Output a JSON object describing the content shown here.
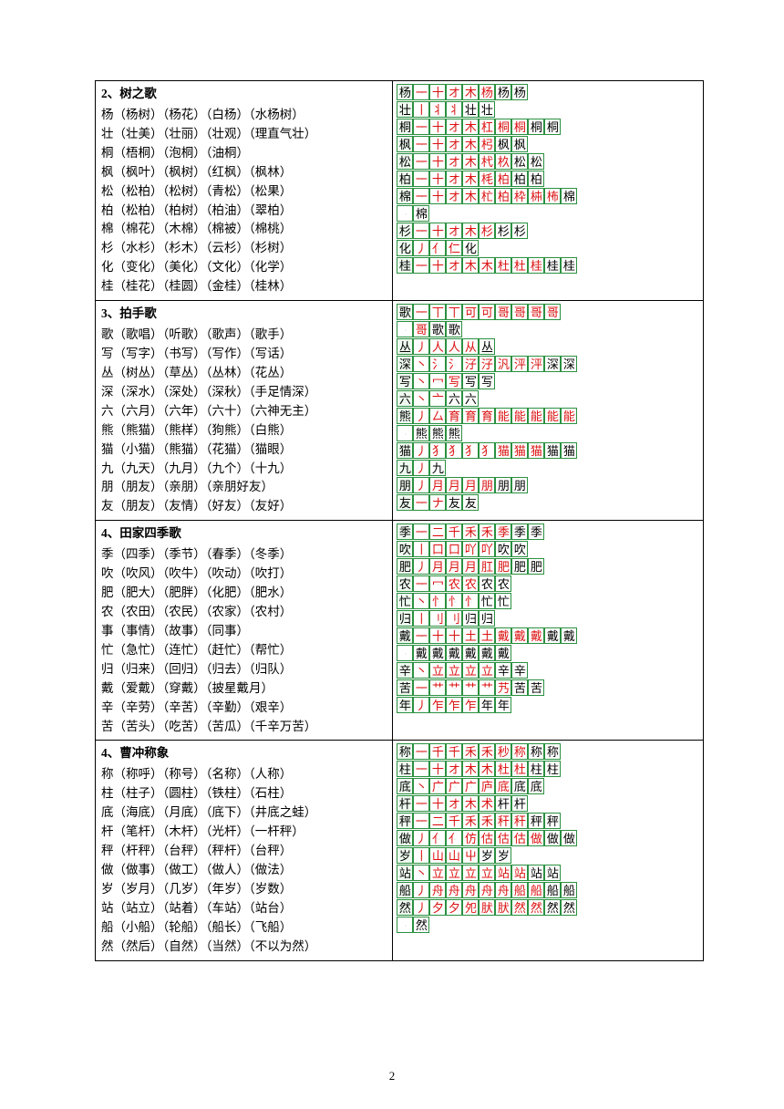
{
  "page_number": "2",
  "sections": [
    {
      "num": "2、",
      "title": "树之歌",
      "entries": [
        "杨（杨树）（杨花）（白杨）（水杨树）",
        "壮（壮美）（壮丽）（壮观）（理直气壮）",
        "桐（梧桐）（泡桐）（油桐）",
        "枫（枫叶）（枫树）（红枫）（枫林）",
        "松（松柏）（松树）（青松）（松果）",
        "柏（松柏）（柏树）（柏油）（翠柏）",
        "棉（棉花）（木棉）（棉被）（棉桃）",
        "杉（水杉）（杉木）（云杉）（杉树）",
        "化（变化）（美化）（文化）（化学）",
        "桂（桂花）（桂圆）（金桂）（桂林）"
      ],
      "strokes": [
        {
          "head": "杨",
          "cells": [
            "一",
            "十",
            "オ",
            "木",
            "杨",
            "杨",
            "杨"
          ]
        },
        {
          "head": "壮",
          "cells": [
            "丨",
            "丬",
            "丬",
            "壮",
            "壮"
          ]
        },
        {
          "head": "桐",
          "cells": [
            "一",
            "十",
            "オ",
            "木",
            "杠",
            "桐",
            "桐",
            "桐",
            "桐"
          ]
        },
        {
          "head": "枫",
          "cells": [
            "一",
            "十",
            "オ",
            "木",
            "杛",
            "枫",
            "枫"
          ]
        },
        {
          "head": "松",
          "cells": [
            "一",
            "十",
            "オ",
            "木",
            "杙",
            "杦",
            "松",
            "松"
          ]
        },
        {
          "head": "柏",
          "cells": [
            "一",
            "十",
            "オ",
            "木",
            "枆",
            "柏",
            "柏",
            "柏"
          ]
        },
        {
          "head": "棉",
          "cells": [
            "一",
            "十",
            "オ",
            "木",
            "杧",
            "柏",
            "枠",
            "枾",
            "柨",
            "棉"
          ],
          "cont": [
            "棉"
          ]
        },
        {
          "head": "杉",
          "cells": [
            "一",
            "十",
            "オ",
            "木",
            "杉",
            "杉",
            "杉"
          ]
        },
        {
          "head": "化",
          "cells": [
            "丿",
            "亻",
            "仁",
            "化"
          ]
        },
        {
          "head": "桂",
          "cells": [
            "一",
            "十",
            "オ",
            "木",
            "木",
            "杜",
            "杜",
            "桂",
            "桂",
            "桂"
          ]
        }
      ]
    },
    {
      "num": "3、",
      "title": "拍手歌",
      "entries": [
        "歌（歌唱）（听歌）（歌声）（歌手）",
        "写（写字）（书写）（写作）（写话）",
        "丛（树丛）（草丛）（丛林）（花丛）",
        "深（深水）（深处）（深秋）（手足情深）",
        "六（六月）（六年）（六十）（六神无主）",
        "熊（熊猫）（熊样）（狗熊）（白熊）",
        "猫（小猫）（熊猫）（花猫）（猫眼）",
        "九（九天）（九月）（九个）（十九）",
        "朋（朋友）（亲朋）（亲朋好友）",
        "友（朋友）（友情）（好友）（友好）"
      ],
      "strokes": [
        {
          "head": "歌",
          "cells": [
            "一",
            "丅",
            "丅",
            "可",
            "可",
            "哥",
            "哥",
            "哥",
            "哥"
          ],
          "cont": [
            "哥",
            "歌",
            "歌"
          ]
        },
        {
          "head": "丛",
          "cells": [
            "丿",
            "人",
            "人",
            "从",
            "丛"
          ]
        },
        {
          "head": "深",
          "cells": [
            "丶",
            "氵",
            "氵",
            "汓",
            "汓",
            "汎",
            "泙",
            "泙",
            "深",
            "深"
          ]
        },
        {
          "head": "写",
          "cells": [
            "丶",
            "冖",
            "写",
            "写",
            "写"
          ]
        },
        {
          "head": "六",
          "cells": [
            "丶",
            "亠",
            "六",
            "六"
          ]
        },
        {
          "head": "熊",
          "cells": [
            "丿",
            "厶",
            "育",
            "育",
            "育",
            "能",
            "能",
            "能",
            "能",
            "能"
          ],
          "cont": [
            "熊",
            "熊",
            "熊"
          ]
        },
        {
          "head": "猫",
          "cells": [
            "丿",
            "犭",
            "犭",
            "犭",
            "犭",
            "猫",
            "猫",
            "猫",
            "猫",
            "猫"
          ]
        },
        {
          "head": "九",
          "cells": [
            "丿",
            "九"
          ]
        },
        {
          "head": "朋",
          "cells": [
            "丿",
            "月",
            "月",
            "月",
            "朋",
            "朋",
            "朋"
          ]
        },
        {
          "head": "友",
          "cells": [
            "一",
            "ナ",
            "友",
            "友"
          ]
        }
      ]
    },
    {
      "num": "4、",
      "title": "田家四季歌",
      "entries": [
        "季（四季）（季节）（春季）（冬季）",
        "吹（吹风）（吹牛）（吹动）（吹打）",
        "肥（肥大）（肥胖）（化肥）（肥水）",
        "农（农田）（农民）（农家）（农村）",
        "事（事情）（故事）（同事）",
        "忙（急忙）（连忙）（赶忙）（帮忙）",
        "归（归来）（回归）（归去）（归队）",
        "戴（爱戴）（穿戴）（披星戴月）",
        "辛（辛劳）（辛苦）（辛勤）（艰辛）",
        "苦（苦头）（吃苦）（苦瓜）（千辛万苦）"
      ],
      "strokes": [
        {
          "head": "季",
          "cells": [
            "一",
            "二",
            "千",
            "禾",
            "禾",
            "季",
            "季",
            "季"
          ]
        },
        {
          "head": "吹",
          "cells": [
            "丨",
            "口",
            "口",
            "吖",
            "吖",
            "吹",
            "吹"
          ]
        },
        {
          "head": "肥",
          "cells": [
            "丿",
            "月",
            "月",
            "月",
            "肛",
            "肥",
            "肥",
            "肥"
          ]
        },
        {
          "head": "农",
          "cells": [
            "一",
            "冖",
            "农",
            "农",
            "农",
            "农"
          ]
        },
        {
          "head": "忙",
          "cells": [
            "丶",
            "忄",
            "忄",
            "忄",
            "忙",
            "忙"
          ]
        },
        {
          "head": "归",
          "cells": [
            "丨",
            "刂",
            "刂",
            "归",
            "归"
          ]
        },
        {
          "head": "戴",
          "cells": [
            "一",
            "十",
            "十",
            "土",
            "土",
            "戴",
            "戴",
            "戴",
            "戴",
            "戴"
          ],
          "cont": [
            "戴",
            "戴",
            "戴",
            "戴",
            "戴",
            "戴"
          ]
        },
        {
          "head": "辛",
          "cells": [
            "丶",
            "立",
            "立",
            "立",
            "立",
            "辛",
            "辛"
          ]
        },
        {
          "head": "苦",
          "cells": [
            "一",
            "艹",
            "艹",
            "艹",
            "艹",
            "艿",
            "苦",
            "苦"
          ]
        },
        {
          "head": "年",
          "cells": [
            "丿",
            "乍",
            "乍",
            "乍",
            "年",
            "年"
          ]
        }
      ]
    },
    {
      "num": "4、",
      "title": "曹冲称象",
      "entries": [
        "称（称呼）（称号）（名称）（人称）",
        "柱（柱子）（圆柱）（铁柱）（石柱）",
        "底（海底）（月底）（底下）（井底之蛙）",
        "杆（笔杆）（木杆）（光杆）（一杆秤）",
        "秤（杆秤）（台秤）（秤杆）（台秤）",
        "做（做事）（做工）（做人）（做法）",
        "岁（岁月）（几岁）（年岁）（岁数）",
        "站（站立）（站着）（车站）（站台）",
        "船（小船）（轮船）（船长）（飞船）",
        "然（然后）（自然）（当然）（不以为然）"
      ],
      "strokes": [
        {
          "head": "称",
          "cells": [
            "一",
            "千",
            "千",
            "禾",
            "禾",
            "秒",
            "称",
            "称",
            "称"
          ]
        },
        {
          "head": "柱",
          "cells": [
            "一",
            "十",
            "オ",
            "木",
            "木",
            "杜",
            "杜",
            "柱",
            "柱"
          ]
        },
        {
          "head": "底",
          "cells": [
            "丶",
            "广",
            "广",
            "广",
            "庐",
            "底",
            "底",
            "底"
          ]
        },
        {
          "head": "杆",
          "cells": [
            "一",
            "十",
            "オ",
            "木",
            "术",
            "杆",
            "杆"
          ]
        },
        {
          "head": "秤",
          "cells": [
            "一",
            "二",
            "千",
            "禾",
            "禾",
            "秆",
            "秆",
            "秤",
            "秤"
          ]
        },
        {
          "head": "做",
          "cells": [
            "丿",
            "亻",
            "亻",
            "仿",
            "估",
            "估",
            "估",
            "做",
            "做",
            "做"
          ]
        },
        {
          "head": "岁",
          "cells": [
            "丨",
            "山",
            "山",
            "屮",
            "岁",
            "岁"
          ]
        },
        {
          "head": "站",
          "cells": [
            "丶",
            "立",
            "立",
            "立",
            "立",
            "站",
            "站",
            "站",
            "站"
          ]
        },
        {
          "head": "船",
          "cells": [
            "丿",
            "舟",
            "舟",
            "舟",
            "舟",
            "舟",
            "船",
            "船",
            "船",
            "船"
          ]
        },
        {
          "head": "然",
          "cells": [
            "丿",
            "夕",
            "夕",
            "夗",
            "肰",
            "肰",
            "然",
            "然",
            "然",
            "然"
          ],
          "cont": [
            "然"
          ]
        }
      ]
    }
  ]
}
